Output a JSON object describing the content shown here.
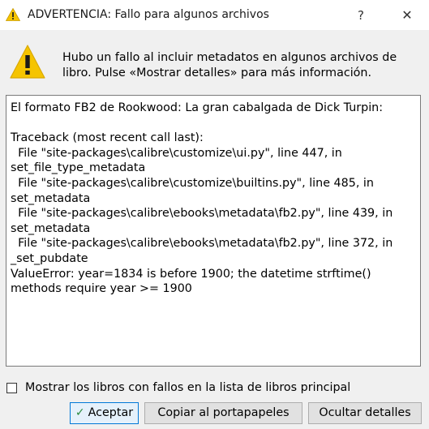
{
  "window": {
    "title": "ADVERTENCIA: Fallo para algunos archivos",
    "help_label": "?",
    "close_label": "✕"
  },
  "message": "Hubo un fallo al incluir metadatos en algunos archivos de libro. Pulse «Mostrar detalles» para más información.",
  "details_text": "El formato FB2 de Rookwood: La gran cabalgada de Dick Turpin:\n\nTraceback (most recent call last):\n  File \"site-packages\\calibre\\customize\\ui.py\", line 447, in\nset_file_type_metadata\n  File \"site-packages\\calibre\\customize\\builtins.py\", line 485, in\nset_metadata\n  File \"site-packages\\calibre\\ebooks\\metadata\\fb2.py\", line 439, in\nset_metadata\n  File \"site-packages\\calibre\\ebooks\\metadata\\fb2.py\", line 372, in\n_set_pubdate\nValueError: year=1834 is before 1900; the datetime strftime()\nmethods require year >= 1900",
  "checkbox": {
    "label": "Mostrar los libros con fallos en la lista de libros principal",
    "checked": false
  },
  "buttons": {
    "accept": "Aceptar",
    "copy": "Copiar al portapapeles",
    "hide_details": "Ocultar detalles"
  },
  "colors": {
    "warning": "#f5c400",
    "accent": "#0078d7"
  },
  "icons": {
    "title": "warning-icon",
    "message": "warning-icon",
    "accept": "checkmark-icon"
  }
}
